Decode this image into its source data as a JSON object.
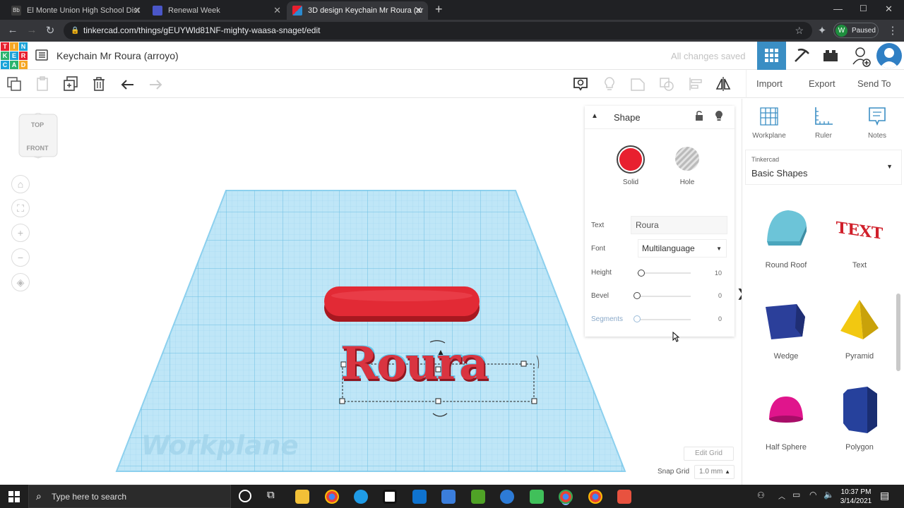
{
  "browser": {
    "tabs": [
      {
        "title": "El Monte Union High School Dist",
        "active": false
      },
      {
        "title": "Renewal Week",
        "active": false
      },
      {
        "title": "3D design Keychain Mr Roura (ar",
        "active": true
      }
    ],
    "url": "tinkercad.com/things/gEUYWld81NF-mighty-waasa-snaget/edit",
    "profile_initial": "W",
    "profile_status": "Paused"
  },
  "header": {
    "logo_letters": [
      "T",
      "I",
      "N",
      "K",
      "E",
      "R",
      "C",
      "A",
      "D"
    ],
    "design_title": "Keychain Mr Roura (arroyo)",
    "save_status": "All changes saved"
  },
  "toolbar": {
    "import_label": "Import",
    "export_label": "Export",
    "sendto_label": "Send To"
  },
  "viewcube": {
    "top": "TOP",
    "front": "FRONT"
  },
  "workplane": {
    "label": "Workplane",
    "object_text": "Roura"
  },
  "inspector": {
    "title": "Shape",
    "solid_label": "Solid",
    "hole_label": "Hole",
    "solid_color": "#e8202f",
    "text_label": "Text",
    "text_value": "Roura",
    "font_label": "Font",
    "font_value": "Multilanguage",
    "height_label": "Height",
    "height_value": "10",
    "height_fraction": 0,
    "bevel_label": "Bevel",
    "bevel_value": "0",
    "segments_label": "Segments",
    "segments_value": "0"
  },
  "grid": {
    "edit_grid_label": "Edit Grid",
    "snap_grid_label": "Snap Grid",
    "snap_grid_value": "1.0 mm"
  },
  "rightpanel": {
    "tools": [
      {
        "label": "Workplane",
        "icon": "workplane-icon"
      },
      {
        "label": "Ruler",
        "icon": "ruler-icon"
      },
      {
        "label": "Notes",
        "icon": "notes-icon"
      }
    ],
    "library_source": "Tinkercad",
    "library_name": "Basic Shapes",
    "shapes": [
      {
        "label": "Round Roof",
        "color": "#6cc4d8"
      },
      {
        "label": "Text",
        "color": "#d01f2a"
      },
      {
        "label": "Wedge",
        "color": "#2b3f9a"
      },
      {
        "label": "Pyramid",
        "color": "#f2c811"
      },
      {
        "label": "Half Sphere",
        "color": "#e0158c"
      },
      {
        "label": "Polygon",
        "color": "#26419c"
      }
    ]
  },
  "taskbar": {
    "search_placeholder": "Type here to search",
    "time": "10:37 PM",
    "date": "3/14/2021"
  }
}
